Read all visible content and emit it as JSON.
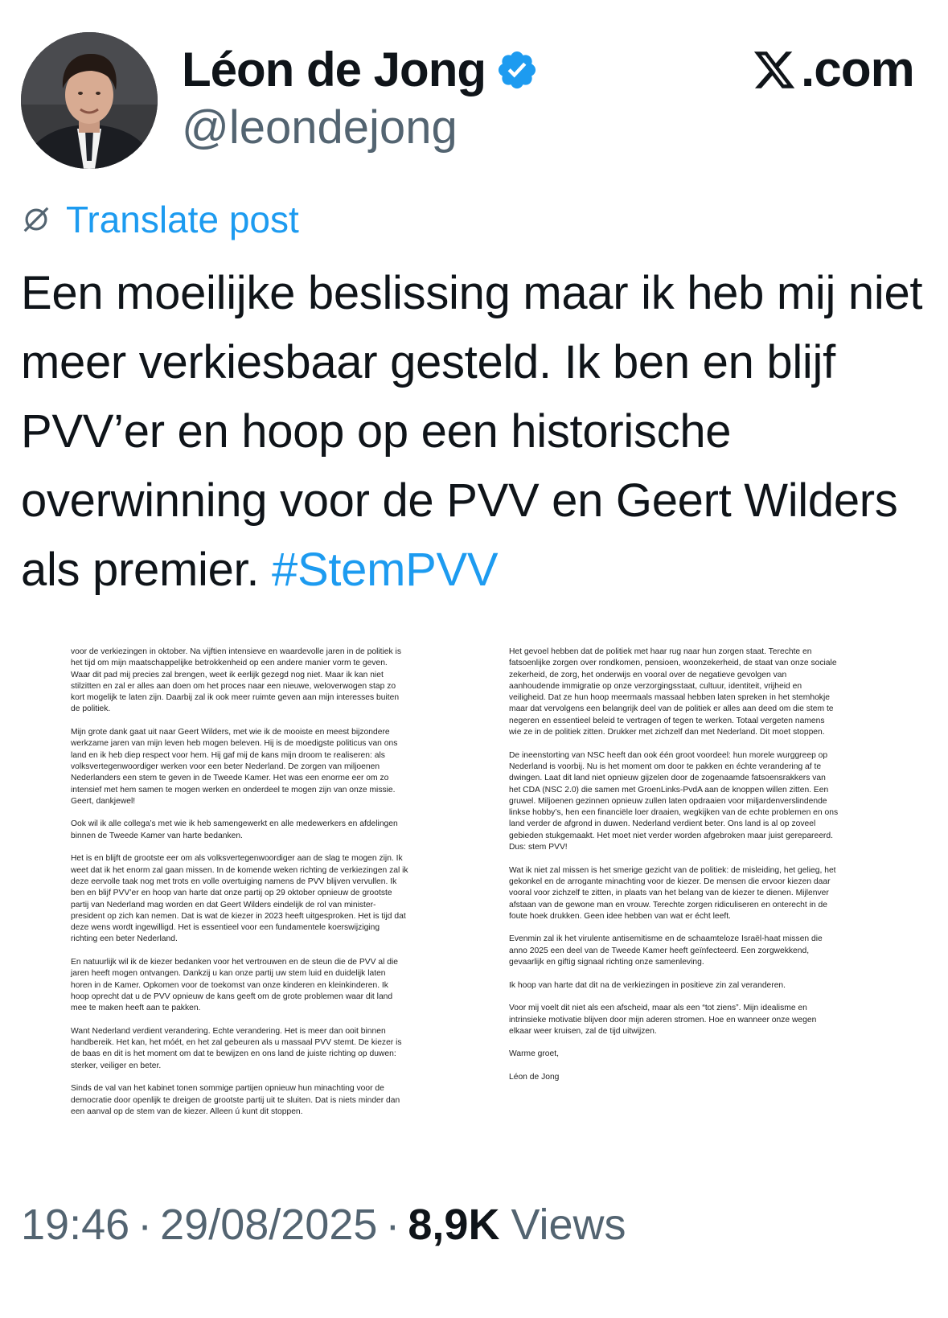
{
  "author": {
    "name": "Léon de Jong",
    "handle": "@leondejong",
    "verified": true
  },
  "brand": {
    "icon": "x-logo-icon",
    "label": ".com"
  },
  "translate": {
    "icon": "globe-icon",
    "label": "Translate post"
  },
  "post": {
    "text": "Een moeilijke beslissing maar ik heb mij niet meer verkiesbaar gesteld. Ik ben en blijf PVV’er en hoop op een historische overwinning voor de PVV en Geert Wilders als premier.",
    "hashtag": "#StemPVV"
  },
  "document": {
    "left_paragraphs": [
      "voor de verkiezingen in oktober. Na vijftien intensieve en waardevolle jaren in de politiek is het tijd om mijn maatschappelijke betrokkenheid op een andere manier vorm te geven. Waar dit pad mij precies zal brengen, weet ik eerlijk gezegd nog niet. Maar ik kan niet stilzitten en zal er alles aan doen om het proces naar een nieuwe, weloverwogen stap zo kort mogelijk te laten zijn. Daarbij zal ik ook meer ruimte geven aan mijn interesses buiten de politiek.",
      "Mijn grote dank gaat uit naar Geert Wilders, met wie ik de mooiste en meest bijzondere werkzame jaren van mijn leven heb mogen beleven. Hij is de moedigste politicus van ons land en ik heb diep respect voor hem. Hij gaf mij de kans mijn droom te realiseren: als volksvertegenwoordiger werken voor een beter Nederland. De zorgen van miljoenen Nederlanders een stem te geven in de Tweede Kamer. Het was een enorme eer om zo intensief met hem samen te mogen werken en onderdeel te mogen zijn van onze missie. Geert, dankjewel!",
      "Ook wil ik alle collega’s met wie ik heb samengewerkt en alle medewerkers en afdelingen binnen de Tweede Kamer van harte bedanken.",
      "Het is en blijft de grootste eer om als volksvertegenwoordiger aan de slag te mogen zijn. Ik weet dat ik het enorm zal gaan missen. In de komende weken richting de verkiezingen zal ik deze eervolle taak nog met trots en volle overtuiging namens de PVV blijven vervullen. Ik ben en blijf PVV’er en hoop van harte dat onze partij op 29 oktober opnieuw de grootste partij van Nederland mag worden en dat Geert Wilders eindelijk de rol van minister-president op zich kan nemen. Dat is wat de kiezer in 2023 heeft uitgesproken. Het is tijd dat deze wens wordt ingewilligd. Het is essentieel voor een fundamentele koerswijziging richting een beter Nederland.",
      "En natuurlijk wil ik de kiezer bedanken voor het vertrouwen en de steun die de PVV al die jaren heeft mogen ontvangen. Dankzij u kan onze partij uw stem luid en duidelijk laten horen in de Kamer. Opkomen voor de toekomst van onze kinderen en kleinkinderen. Ik hoop oprecht dat u de PVV opnieuw de kans geeft om de grote problemen waar dit land mee te maken heeft aan te pakken.",
      "Want Nederland verdient verandering. Echte verandering. Het is meer dan ooit binnen handbereik. Het kan, het móét, en het zal gebeuren als u massaal PVV stemt. De kiezer is de baas en dit is het moment om dat te bewijzen en ons land de juiste richting op duwen: sterker, veiliger en beter.",
      "Sinds de val van het kabinet tonen sommige partijen opnieuw hun minachting voor de democratie door openlijk te dreigen de grootste partij uit te sluiten. Dat is niets minder dan een aanval op de stem van de kiezer. Alleen ú kunt dit stoppen."
    ],
    "right_paragraphs": [
      "Het gevoel hebben dat de politiek met haar rug naar hun zorgen staat. Terechte en fatsoenlijke zorgen over rondkomen, pensioen, woonzekerheid, de staat van onze sociale zekerheid, de zorg, het onderwijs en vooral over de negatieve gevolgen van aanhoudende immigratie op onze verzorgingsstaat, cultuur, identiteit, vrijheid en veiligheid. Dat ze hun hoop meermaals massaal hebben laten spreken in het stemhokje maar dat vervolgens een belangrijk deel van de politiek er alles aan deed om die stem te negeren en essentieel beleid te vertragen of tegen te werken. Totaal vergeten namens wie ze in de politiek zitten. Drukker met zichzelf dan met Nederland. Dit moet stoppen.",
      "De ineenstorting van NSC heeft dan ook één groot voordeel: hun morele wurggreep op Nederland is voorbij. Nu is het moment om door te pakken en échte verandering af te dwingen. Laat dit land niet opnieuw gijzelen door de zogenaamde fatsoensrakkers van het CDA (NSC 2.0) die samen met GroenLinks-PvdA aan de knoppen willen zitten. Een gruwel. Miljoenen gezinnen opnieuw zullen laten opdraaien voor miljardenverslindende linkse hobby’s, hen een financiële loer draaien, wegkijken van de echte problemen en ons land verder de afgrond in duwen. Nederland verdient beter. Ons land is al op zoveel gebieden stukgemaakt. Het moet niet verder worden afgebroken maar juist gerepareerd. Dus: stem PVV!",
      "Wat ik niet zal missen is het smerige gezicht van de politiek: de misleiding, het gelieg, het gekonkel en de arrogante minachting voor de kiezer. De mensen die ervoor kiezen daar vooral voor zichzelf te zitten, in plaats van het belang van de kiezer te dienen. Mijlenver afstaan van de gewone man en vrouw. Terechte zorgen ridiculiseren en onterecht in de foute hoek drukken. Geen idee hebben van wat er écht leeft.",
      "Evenmin zal ik het virulente antisemitisme en de schaamteloze Israël-haat missen die anno 2025 een deel van de Tweede Kamer heeft geïnfecteerd. Een zorgwekkend, gevaarlijk en giftig signaal richting onze samenleving.",
      "Ik hoop van harte dat dit na de verkiezingen in positieve zin zal veranderen.",
      "Voor mij voelt dit niet als een afscheid, maar als een “tot ziens”. Mijn idealisme en intrinsieke motivatie blijven door mijn aderen stromen. Hoe en wanneer onze wegen elkaar weer kruisen, zal de tijd uitwijzen.",
      "Warme groet,",
      "Léon de Jong"
    ]
  },
  "meta": {
    "time": "19:46",
    "separator": "·",
    "date": "29/08/2025",
    "views_count": "8,9K",
    "views_label": "Views"
  },
  "colors": {
    "link": "#1d9bf0",
    "text": "#0f1419",
    "secondary": "#536471"
  }
}
